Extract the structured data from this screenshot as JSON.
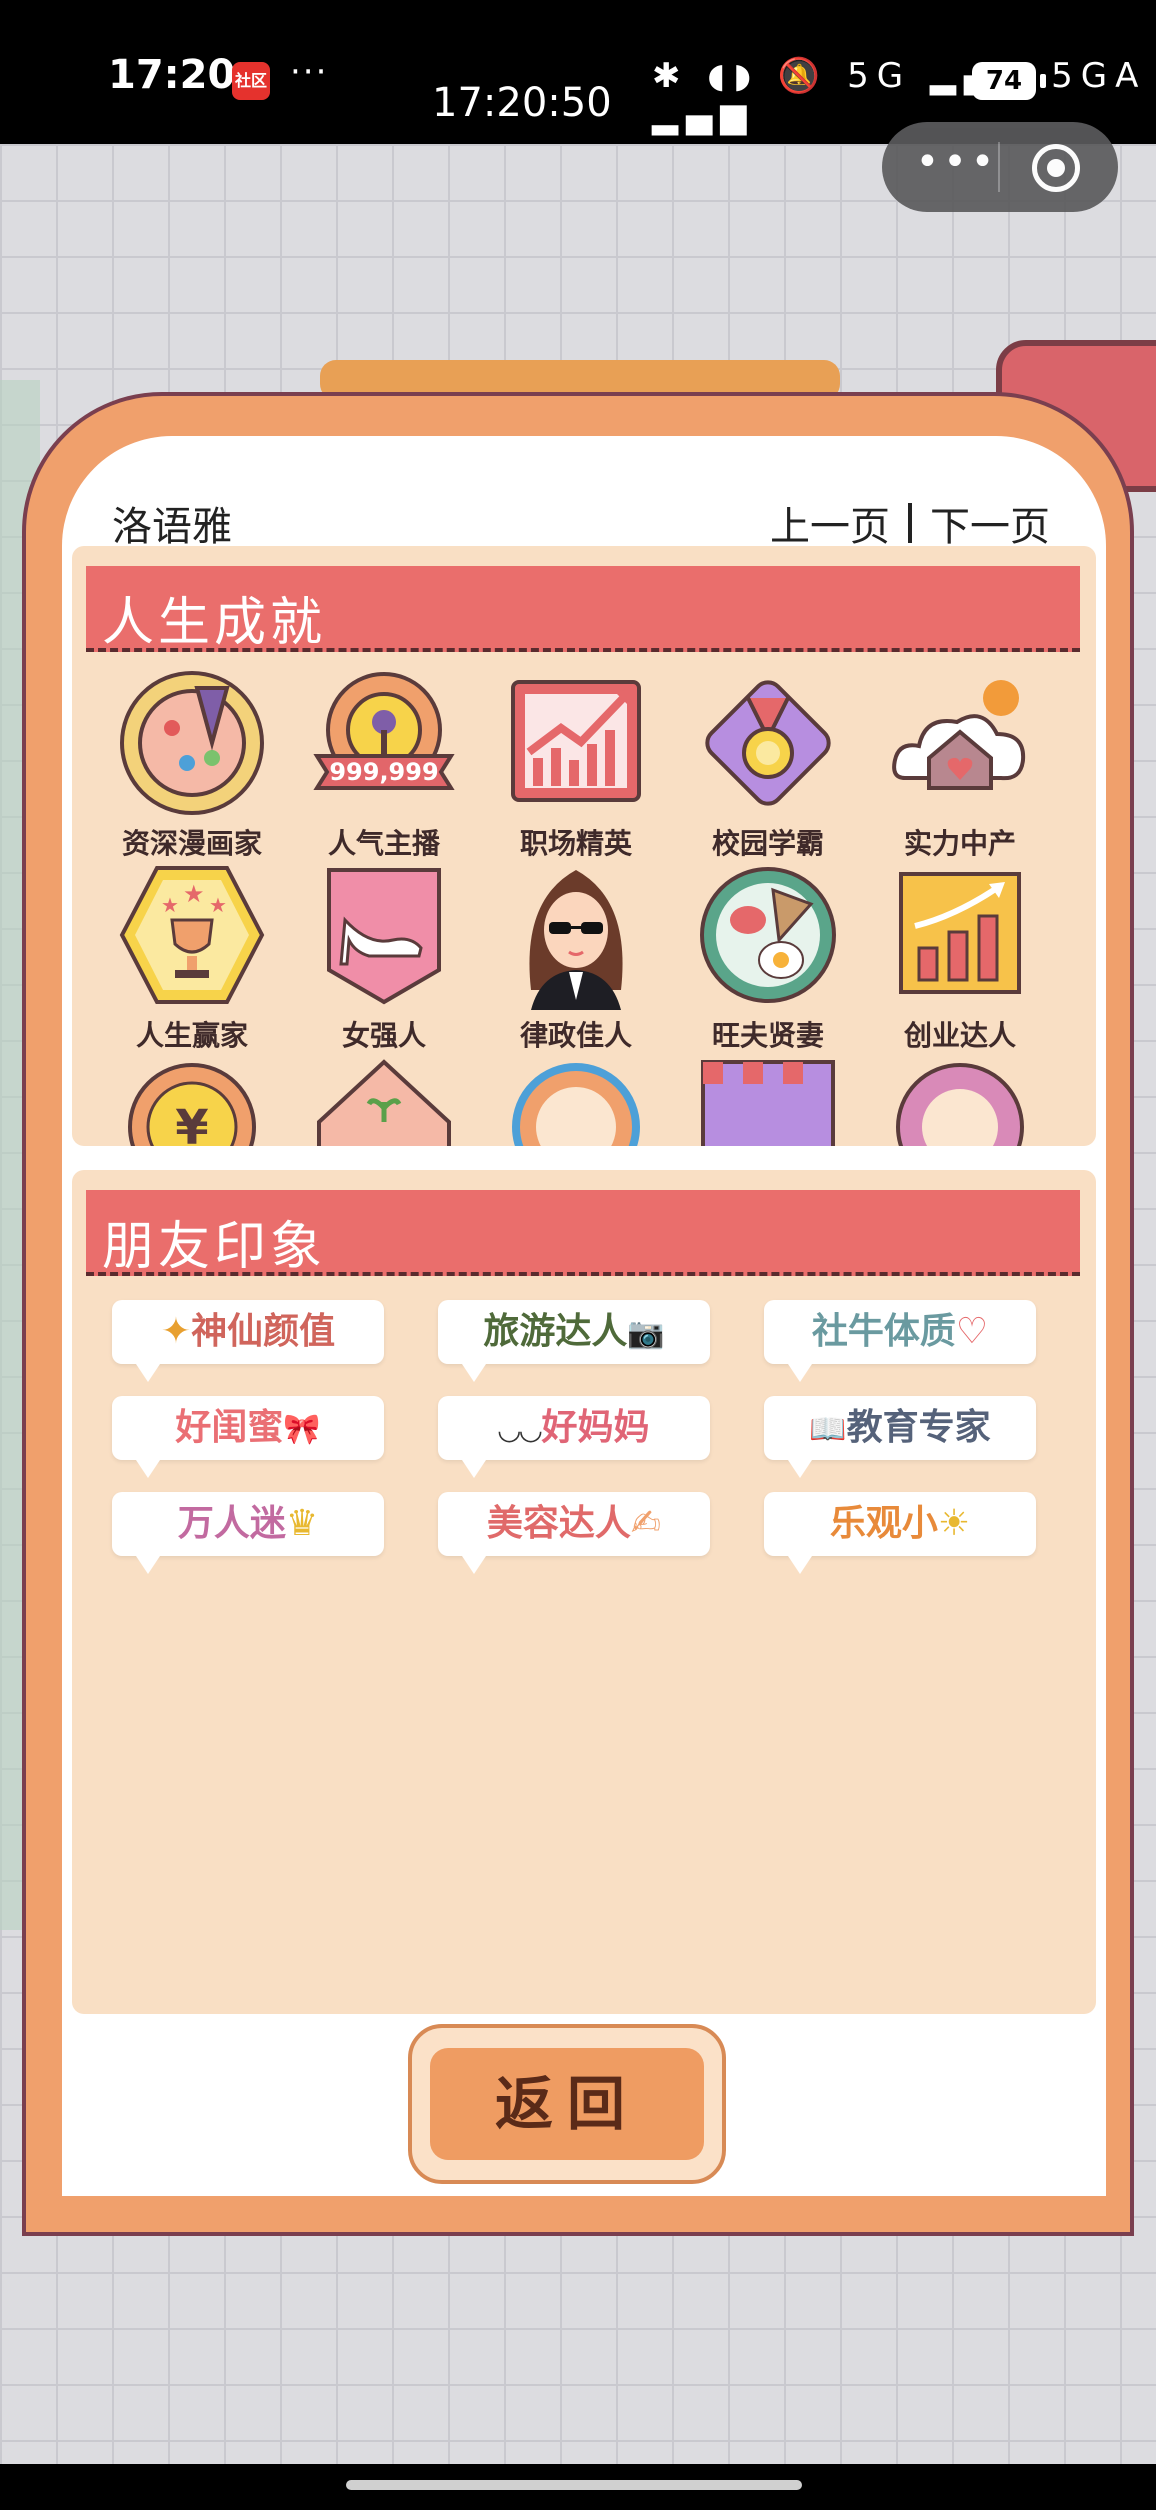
{
  "status_bar": {
    "time": "17:20",
    "app_badge": "社区",
    "more": "···",
    "clock": "17:20:50",
    "icons": "✱ ◖◗ 🔕 5G ▂▄▆ 5GA ▂▄▆",
    "battery": "74"
  },
  "capsule": {
    "more_label": "•••"
  },
  "header": {
    "owner_name": "洛语雅",
    "prev_label": "上一页",
    "next_label": "下一页"
  },
  "achievements": {
    "title": "人生成就",
    "items": [
      {
        "label": "资深漫画家",
        "icon": "palette-icon"
      },
      {
        "label": "人气主播",
        "icon": "microphone-icon",
        "badge": "999,999"
      },
      {
        "label": "职场精英",
        "icon": "rising-chart-icon"
      },
      {
        "label": "校园学霸",
        "icon": "medal-icon"
      },
      {
        "label": "实力中产",
        "icon": "house-cloud-icon"
      },
      {
        "label": "人生赢家",
        "icon": "trophy-icon"
      },
      {
        "label": "女强人",
        "icon": "high-heel-icon"
      },
      {
        "label": "律政佳人",
        "icon": "lawyer-woman-icon"
      },
      {
        "label": "旺夫贤妻",
        "icon": "breakfast-plate-icon"
      },
      {
        "label": "创业达人",
        "icon": "growth-bars-icon"
      }
    ]
  },
  "impressions": {
    "title": "朋友印象",
    "tags": [
      {
        "label": "神仙颜值",
        "icon": "✦",
        "color": "#d0655c"
      },
      {
        "label": "旅游达人",
        "icon": "📷",
        "color": "#4f6a3a"
      },
      {
        "label": "社牛体质",
        "icon": "♡",
        "color": "#6a9aa0"
      },
      {
        "label": "好闺蜜",
        "icon": "🎀",
        "color": "#ea6f74"
      },
      {
        "label": "好妈妈",
        "icon": "◡◡",
        "color": "#e06576"
      },
      {
        "label": "教育专家",
        "icon": "📖",
        "color": "#55627a"
      },
      {
        "label": "万人迷",
        "icon": "♛",
        "color": "#c26aa0"
      },
      {
        "label": "美容达人",
        "icon": "✍",
        "color": "#e06a6a"
      },
      {
        "label": "乐观小",
        "icon": "☀",
        "color": "#e88a3a"
      }
    ]
  },
  "footer": {
    "return_label": "返回"
  },
  "colors": {
    "card_frame": "#f0a06c",
    "banner": "#ea6e6c",
    "panel": "#f9dfc4"
  }
}
